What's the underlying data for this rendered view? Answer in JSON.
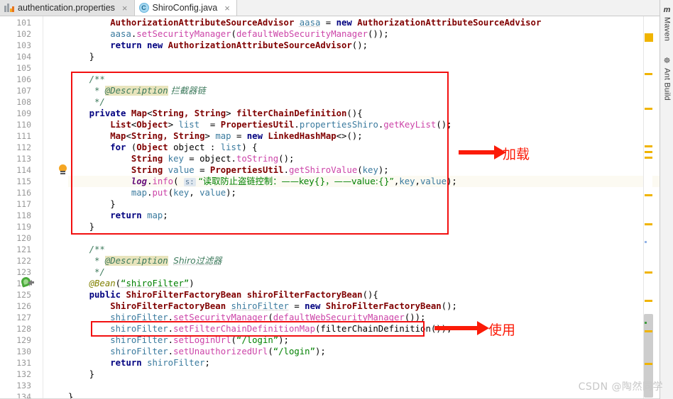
{
  "window": {
    "app": "IntelliJ IDEA Editor",
    "watermark": "CSDN @陶然同学"
  },
  "tabs": [
    {
      "label": "authentication.properties",
      "icon": "properties-file-icon",
      "close": "×",
      "active": false
    },
    {
      "label": "ShiroConfig.java",
      "icon": "java-class-icon",
      "close": "×",
      "active": true,
      "icon_letter": "C"
    }
  ],
  "editor": {
    "first_line": 101,
    "last_line": 134,
    "highlighted_line": 115,
    "bean_gutter_line": 124,
    "bulb_gutter_line": 114,
    "line_numbers": [
      101,
      102,
      103,
      104,
      105,
      106,
      107,
      108,
      109,
      110,
      111,
      112,
      113,
      114,
      115,
      116,
      117,
      118,
      119,
      120,
      121,
      122,
      123,
      124,
      125,
      126,
      127,
      128,
      129,
      130,
      131,
      132,
      133,
      134
    ],
    "lines": [
      {
        "n": 101,
        "clipped": true,
        "segments": [
          {
            "t": "        ",
            "c": "plain"
          },
          {
            "t": "AuthorizationAttributeSourceAdvisor ",
            "c": "cls"
          },
          {
            "t": "aasa",
            "c": "loc und"
          },
          {
            "t": " = ",
            "c": "plain"
          },
          {
            "t": "new ",
            "c": "kw"
          },
          {
            "t": "AuthorizationAttributeSourceAdvisor",
            "c": "cls"
          }
        ]
      },
      {
        "n": 102,
        "segments": [
          {
            "t": "        ",
            "c": "plain"
          },
          {
            "t": "aasa",
            "c": "loc"
          },
          {
            "t": ".",
            "c": "plain"
          },
          {
            "t": "setSecurityManager",
            "c": "mth"
          },
          {
            "t": "(",
            "c": "plain"
          },
          {
            "t": "defaultWebSecurityManager",
            "c": "mth"
          },
          {
            "t": "());",
            "c": "plain"
          }
        ]
      },
      {
        "n": 103,
        "segments": [
          {
            "t": "        ",
            "c": "plain"
          },
          {
            "t": "return new ",
            "c": "kw"
          },
          {
            "t": "AuthorizationAttributeSourceAdvisor",
            "c": "cls"
          },
          {
            "t": "();",
            "c": "plain"
          }
        ]
      },
      {
        "n": 104,
        "segments": [
          {
            "t": "    }",
            "c": "plain"
          }
        ]
      },
      {
        "n": 105,
        "segments": []
      },
      {
        "n": 106,
        "segments": [
          {
            "t": "    /**",
            "c": "cmtd"
          }
        ]
      },
      {
        "n": 107,
        "segments": [
          {
            "t": "     * ",
            "c": "cmtd"
          },
          {
            "t": "@Description",
            "c": "tag"
          },
          {
            "t": " 拦截器链",
            "c": "cmtd zh"
          }
        ]
      },
      {
        "n": 108,
        "segments": [
          {
            "t": "     */",
            "c": "cmtd"
          }
        ]
      },
      {
        "n": 109,
        "segments": [
          {
            "t": "    private ",
            "c": "kw"
          },
          {
            "t": "Map",
            "c": "cls"
          },
          {
            "t": "<",
            "c": "plain"
          },
          {
            "t": "String, String",
            "c": "cls"
          },
          {
            "t": "> ",
            "c": "plain"
          },
          {
            "t": "filterChainDefinition",
            "c": "cls"
          },
          {
            "t": "(){",
            "c": "plain"
          }
        ]
      },
      {
        "n": 110,
        "segments": [
          {
            "t": "        ",
            "c": "plain"
          },
          {
            "t": "List",
            "c": "cls"
          },
          {
            "t": "<",
            "c": "plain"
          },
          {
            "t": "Object",
            "c": "cls"
          },
          {
            "t": "> ",
            "c": "plain"
          },
          {
            "t": "list",
            "c": "loc"
          },
          {
            "t": "  = ",
            "c": "plain"
          },
          {
            "t": "PropertiesUtil",
            "c": "cls"
          },
          {
            "t": ".",
            "c": "plain"
          },
          {
            "t": "propertiesShiro",
            "c": "loc"
          },
          {
            "t": ".",
            "c": "plain"
          },
          {
            "t": "getKeyList",
            "c": "mth"
          },
          {
            "t": "();",
            "c": "plain"
          }
        ]
      },
      {
        "n": 111,
        "segments": [
          {
            "t": "        ",
            "c": "plain"
          },
          {
            "t": "Map",
            "c": "cls"
          },
          {
            "t": "<",
            "c": "plain"
          },
          {
            "t": "String, String",
            "c": "cls"
          },
          {
            "t": "> ",
            "c": "plain"
          },
          {
            "t": "map",
            "c": "loc"
          },
          {
            "t": " = ",
            "c": "plain"
          },
          {
            "t": "new ",
            "c": "kw"
          },
          {
            "t": "LinkedHashMap",
            "c": "cls"
          },
          {
            "t": "<>();",
            "c": "plain"
          }
        ]
      },
      {
        "n": 112,
        "segments": [
          {
            "t": "        ",
            "c": "plain"
          },
          {
            "t": "for ",
            "c": "kw"
          },
          {
            "t": "(",
            "c": "plain"
          },
          {
            "t": "Object",
            "c": "cls"
          },
          {
            "t": " object : ",
            "c": "plain"
          },
          {
            "t": "list",
            "c": "loc"
          },
          {
            "t": ") {",
            "c": "plain"
          }
        ]
      },
      {
        "n": 113,
        "segments": [
          {
            "t": "            ",
            "c": "plain"
          },
          {
            "t": "String",
            "c": "cls"
          },
          {
            "t": " ",
            "c": "plain"
          },
          {
            "t": "key",
            "c": "loc"
          },
          {
            "t": " = object.",
            "c": "plain"
          },
          {
            "t": "toString",
            "c": "mth"
          },
          {
            "t": "();",
            "c": "plain"
          }
        ]
      },
      {
        "n": 114,
        "segments": [
          {
            "t": "            ",
            "c": "plain"
          },
          {
            "t": "String",
            "c": "cls"
          },
          {
            "t": " ",
            "c": "plain"
          },
          {
            "t": "value",
            "c": "loc"
          },
          {
            "t": " = ",
            "c": "plain"
          },
          {
            "t": "PropertiesUtil",
            "c": "cls"
          },
          {
            "t": ".",
            "c": "plain"
          },
          {
            "t": "getShiroValue",
            "c": "mth"
          },
          {
            "t": "(",
            "c": "plain"
          },
          {
            "t": "key",
            "c": "loc"
          },
          {
            "t": ");",
            "c": "plain"
          }
        ]
      },
      {
        "n": 115,
        "segments": [
          {
            "t": "            ",
            "c": "plain"
          },
          {
            "t": "log",
            "c": "fld"
          },
          {
            "t": ".",
            "c": "plain"
          },
          {
            "t": "info",
            "c": "mth"
          },
          {
            "t": "( ",
            "c": "plain"
          },
          {
            "t": "s:",
            "c": "hintp"
          },
          {
            "t": " “读取防止盗链控制：——key{}，——value:{}”",
            "c": "str zh"
          },
          {
            "t": ",",
            "c": "plain"
          },
          {
            "t": "key",
            "c": "loc"
          },
          {
            "t": ",",
            "c": "plain"
          },
          {
            "t": "value",
            "c": "loc"
          },
          {
            "t": ");",
            "c": "plain"
          }
        ]
      },
      {
        "n": 116,
        "segments": [
          {
            "t": "            ",
            "c": "plain"
          },
          {
            "t": "map",
            "c": "loc"
          },
          {
            "t": ".",
            "c": "plain"
          },
          {
            "t": "put",
            "c": "mth"
          },
          {
            "t": "(",
            "c": "plain"
          },
          {
            "t": "key",
            "c": "loc"
          },
          {
            "t": ", ",
            "c": "plain"
          },
          {
            "t": "value",
            "c": "loc"
          },
          {
            "t": ");",
            "c": "plain"
          }
        ]
      },
      {
        "n": 117,
        "segments": [
          {
            "t": "        }",
            "c": "plain"
          }
        ]
      },
      {
        "n": 118,
        "segments": [
          {
            "t": "        ",
            "c": "plain"
          },
          {
            "t": "return ",
            "c": "kw"
          },
          {
            "t": "map",
            "c": "loc"
          },
          {
            "t": ";",
            "c": "plain"
          }
        ]
      },
      {
        "n": 119,
        "segments": [
          {
            "t": "    }",
            "c": "plain"
          }
        ]
      },
      {
        "n": 120,
        "segments": []
      },
      {
        "n": 121,
        "segments": [
          {
            "t": "    /**",
            "c": "cmtd"
          }
        ]
      },
      {
        "n": 122,
        "segments": [
          {
            "t": "     * ",
            "c": "cmtd"
          },
          {
            "t": "@Description",
            "c": "tag"
          },
          {
            "t": " ",
            "c": "cmtd"
          },
          {
            "t": "Shiro过滤器",
            "c": "cmtd und zh"
          }
        ]
      },
      {
        "n": 123,
        "segments": [
          {
            "t": "     */",
            "c": "cmtd"
          }
        ]
      },
      {
        "n": 124,
        "segments": [
          {
            "t": "    @Bean",
            "c": "anno"
          },
          {
            "t": "(",
            "c": "plain"
          },
          {
            "t": "“shiroFilter”",
            "c": "str und"
          },
          {
            "t": ")",
            "c": "plain"
          }
        ]
      },
      {
        "n": 125,
        "segments": [
          {
            "t": "    public ",
            "c": "kw"
          },
          {
            "t": "ShiroFilterFactoryBean shiroFilterFactoryBean",
            "c": "cls"
          },
          {
            "t": "(){",
            "c": "plain"
          }
        ]
      },
      {
        "n": 126,
        "segments": [
          {
            "t": "        ",
            "c": "plain"
          },
          {
            "t": "ShiroFilterFactoryBean",
            "c": "cls"
          },
          {
            "t": " ",
            "c": "plain"
          },
          {
            "t": "shiroFilter",
            "c": "loc und"
          },
          {
            "t": " = ",
            "c": "plain"
          },
          {
            "t": "new ",
            "c": "kw"
          },
          {
            "t": "ShiroFilterFactoryBean",
            "c": "cls"
          },
          {
            "t": "();",
            "c": "plain"
          }
        ]
      },
      {
        "n": 127,
        "segments": [
          {
            "t": "        ",
            "c": "plain"
          },
          {
            "t": "shiroFilter",
            "c": "loc und"
          },
          {
            "t": ".",
            "c": "plain"
          },
          {
            "t": "setSecurityManager",
            "c": "mth"
          },
          {
            "t": "(",
            "c": "plain"
          },
          {
            "t": "defaultWebSecurityManager",
            "c": "mth und"
          },
          {
            "t": "());",
            "c": "plain"
          }
        ]
      },
      {
        "n": 128,
        "segments": [
          {
            "t": "        ",
            "c": "plain"
          },
          {
            "t": "shiroFilter",
            "c": "loc"
          },
          {
            "t": ".",
            "c": "plain"
          },
          {
            "t": "setFilterChainDefinitionMap",
            "c": "mth"
          },
          {
            "t": "(",
            "c": "plain"
          },
          {
            "t": "filterChainDefinition",
            "c": "plain"
          },
          {
            "t": "());",
            "c": "plain"
          }
        ]
      },
      {
        "n": 129,
        "segments": [
          {
            "t": "        ",
            "c": "plain"
          },
          {
            "t": "shiroFilter",
            "c": "loc"
          },
          {
            "t": ".",
            "c": "plain"
          },
          {
            "t": "setLoginUrl",
            "c": "mth"
          },
          {
            "t": "(",
            "c": "plain"
          },
          {
            "t": "“/login”",
            "c": "str"
          },
          {
            "t": ");",
            "c": "plain"
          }
        ]
      },
      {
        "n": 130,
        "segments": [
          {
            "t": "        ",
            "c": "plain"
          },
          {
            "t": "shiroFilter",
            "c": "loc"
          },
          {
            "t": ".",
            "c": "plain"
          },
          {
            "t": "setUnauthorizedUrl",
            "c": "mth"
          },
          {
            "t": "(",
            "c": "plain"
          },
          {
            "t": "“/login”",
            "c": "str"
          },
          {
            "t": ");",
            "c": "plain"
          }
        ]
      },
      {
        "n": 131,
        "segments": [
          {
            "t": "        ",
            "c": "plain"
          },
          {
            "t": "return ",
            "c": "kw"
          },
          {
            "t": "shiroFilter",
            "c": "loc"
          },
          {
            "t": ";",
            "c": "plain"
          }
        ]
      },
      {
        "n": 132,
        "segments": [
          {
            "t": "    }",
            "c": "plain"
          }
        ]
      },
      {
        "n": 133,
        "segments": []
      },
      {
        "n": 134,
        "segments": [
          {
            "t": "}",
            "c": "plain"
          }
        ]
      }
    ]
  },
  "annotations": {
    "color": "#fb1b08",
    "boxes": [
      {
        "name": "filter-chain-definition-box",
        "line_from": 106,
        "line_to": 119
      },
      {
        "name": "set-filter-chain-definition-map-box",
        "line_from": 128,
        "line_to": 128
      }
    ],
    "arrows": [
      {
        "name": "load-arrow",
        "label": "加载"
      },
      {
        "name": "use-arrow",
        "label": "使用"
      }
    ],
    "load_label": "加载",
    "use_label": "使用"
  },
  "right_toolwindows": [
    {
      "label": "Maven",
      "icon": "maven-icon",
      "glyph": "m"
    },
    {
      "label": "Ant Build",
      "icon": "ant-icon",
      "glyph": "☸"
    }
  ],
  "markers": {
    "warning_color": "#f0b400",
    "info_color": "#3f9b3f",
    "blue_color": "#93b3e6",
    "warning_positions": [
      24,
      80,
      129,
      182,
      190,
      198,
      251,
      292,
      360,
      400,
      443,
      489
    ],
    "info_positions": [
      431
    ],
    "blue_positions": [
      317
    ]
  }
}
